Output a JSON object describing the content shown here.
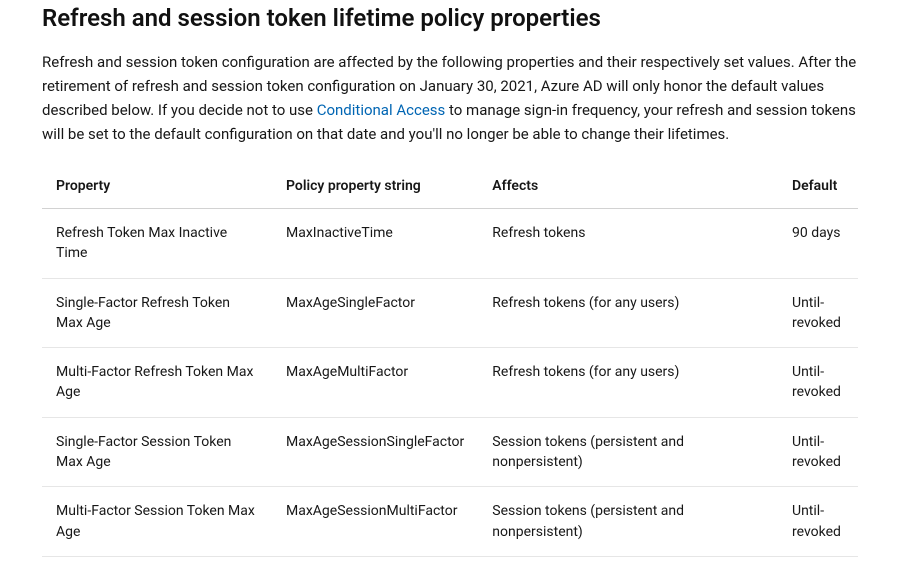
{
  "heading": "Refresh and session token lifetime policy properties",
  "intro_pre": "Refresh and session token configuration are affected by the following properties and their respectively set values. After the retirement of refresh and session token configuration on January 30, 2021, Azure AD will only honor the default values described below. If you decide not to use ",
  "intro_link": "Conditional Access",
  "intro_post": " to manage sign-in frequency, your refresh and session tokens will be set to the default configuration on that date and you'll no longer be able to change their lifetimes.",
  "table": {
    "headers": {
      "property": "Property",
      "policy": "Policy property string",
      "affects": "Affects",
      "default": "Default"
    },
    "rows": [
      {
        "property": "Refresh Token Max Inactive Time",
        "policy": "MaxInactiveTime",
        "affects": "Refresh tokens",
        "default": "90 days"
      },
      {
        "property": "Single-Factor Refresh Token Max Age",
        "policy": "MaxAgeSingleFactor",
        "affects": "Refresh tokens (for any users)",
        "default": "Until-revoked"
      },
      {
        "property": "Multi-Factor Refresh Token Max Age",
        "policy": "MaxAgeMultiFactor",
        "affects": "Refresh tokens (for any users)",
        "default": "Until-revoked"
      },
      {
        "property": "Single-Factor Session Token Max Age",
        "policy": "MaxAgeSessionSingleFactor",
        "affects": "Session tokens (persistent and nonpersistent)",
        "default": "Until-revoked"
      },
      {
        "property": "Multi-Factor Session Token Max Age",
        "policy": "MaxAgeSessionMultiFactor",
        "affects": "Session tokens (persistent and nonpersistent)",
        "default": "Until-revoked"
      }
    ]
  }
}
